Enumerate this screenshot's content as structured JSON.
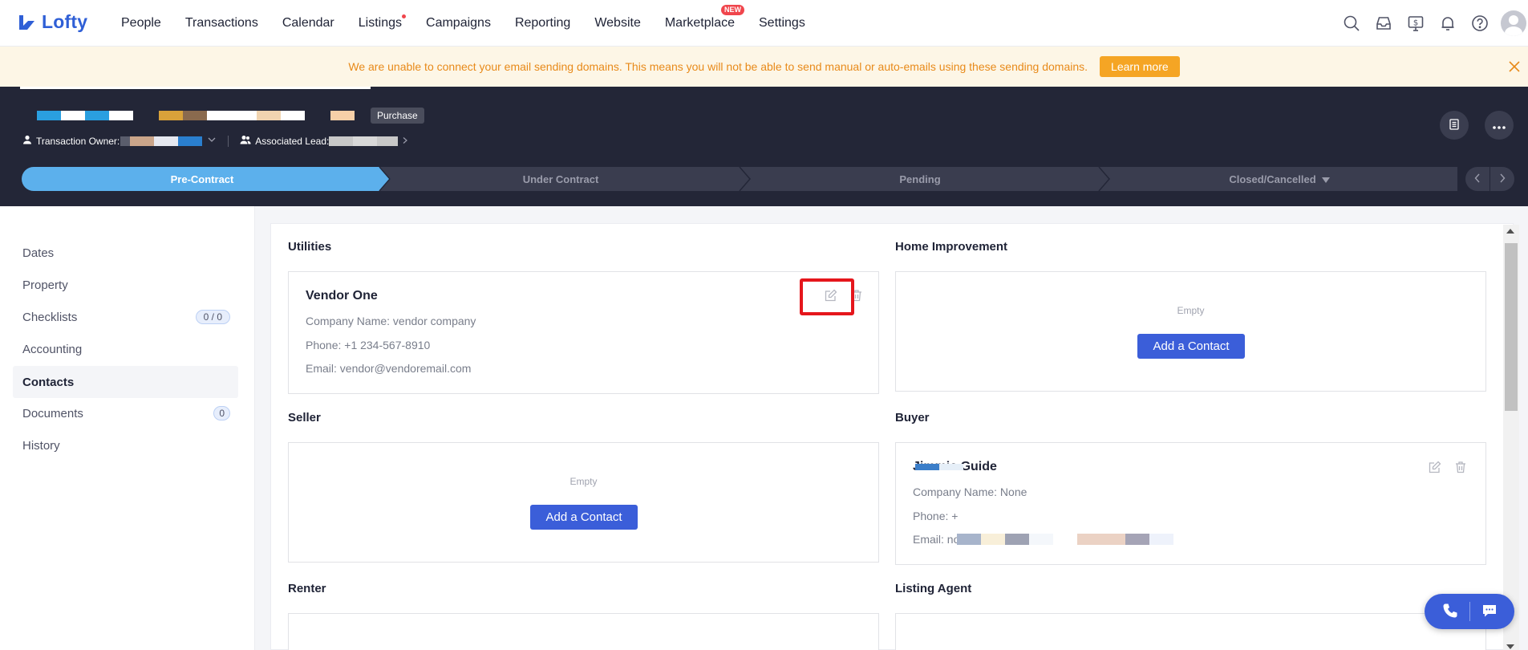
{
  "app": {
    "brand": "Lofty"
  },
  "nav": {
    "items": [
      {
        "label": "People"
      },
      {
        "label": "Transactions"
      },
      {
        "label": "Calendar"
      },
      {
        "label": "Listings"
      },
      {
        "label": "Campaigns"
      },
      {
        "label": "Reporting"
      },
      {
        "label": "Website"
      },
      {
        "label": "Marketplace"
      },
      {
        "label": "Settings"
      }
    ],
    "new_badge": "NEW",
    "icons": [
      "search-icon",
      "inbox-icon",
      "billing-icon",
      "bell-icon",
      "help-icon",
      "avatar"
    ]
  },
  "banner": {
    "text": "We are unable to connect your email sending domains. This means you will not be able to send manual or auto-emails using these sending domains.",
    "button": "Learn more"
  },
  "transaction": {
    "type_tag": "Purchase",
    "owner_label": "Transaction Owner:",
    "lead_label": "Associated Lead:"
  },
  "stages": [
    {
      "label": "Pre-Contract",
      "active": true
    },
    {
      "label": "Under Contract",
      "active": false
    },
    {
      "label": "Pending",
      "active": false
    },
    {
      "label": "Closed/Cancelled",
      "active": false
    }
  ],
  "sidebar": {
    "items": [
      {
        "label": "Dates"
      },
      {
        "label": "Property"
      },
      {
        "label": "Checklists",
        "badge": "0 / 0"
      },
      {
        "label": "Accounting"
      },
      {
        "label": "Contacts",
        "active": true
      },
      {
        "label": "Documents",
        "badge": "0"
      },
      {
        "label": "History"
      }
    ]
  },
  "sections": {
    "utilities": {
      "title": "Utilities",
      "contact": {
        "name": "Vendor One",
        "company": "Company Name: vendor company",
        "phone": "Phone: +1 234-567-8910",
        "email": "Email: vendor@vendoremail.com"
      }
    },
    "home_improvement": {
      "title": "Home Improvement",
      "empty": "Empty",
      "button": "Add a Contact"
    },
    "seller": {
      "title": "Seller",
      "empty": "Empty",
      "button": "Add a Contact"
    },
    "buyer": {
      "title": "Buyer",
      "contact": {
        "name": "Jimmie Guide",
        "company": "Company Name: None",
        "phone": "Phone: +",
        "email": "Email: no"
      }
    },
    "renter": {
      "title": "Renter"
    },
    "listing_agent": {
      "title": "Listing Agent"
    }
  },
  "colors": {
    "brand": "#2f5fd6",
    "primary_button": "#3b5ed9",
    "active_stage": "#5cb0ec",
    "header_bg": "#232637",
    "banner_bg": "#fdf6e6",
    "banner_text": "#e88a1a",
    "banner_button": "#f5a524",
    "highlight": "#e5161c"
  }
}
